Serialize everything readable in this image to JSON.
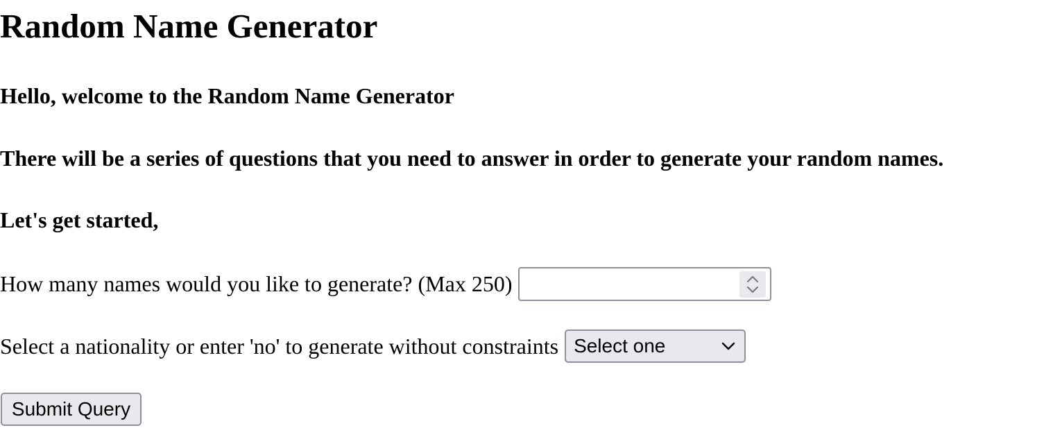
{
  "page": {
    "title": "Random Name Generator"
  },
  "intro": {
    "welcome": "Hello, welcome to the Random Name Generator",
    "series": "There will be a series of questions that you need to answer in order to generate your random names.",
    "started": "Let's get started,"
  },
  "form": {
    "count_label": "How many names would you like to generate? (Max 250)",
    "count_value": "",
    "nationality_label": "Select a nationality or enter 'no' to generate without constraints",
    "nationality_selected": "Select one",
    "submit_label": "Submit Query"
  },
  "icons": {
    "spinner": "up-down-spinner-icon",
    "dropdown": "chevron-down-icon"
  },
  "colors": {
    "control_border": "#8f8f9d",
    "control_background": "#e9e9ed"
  }
}
